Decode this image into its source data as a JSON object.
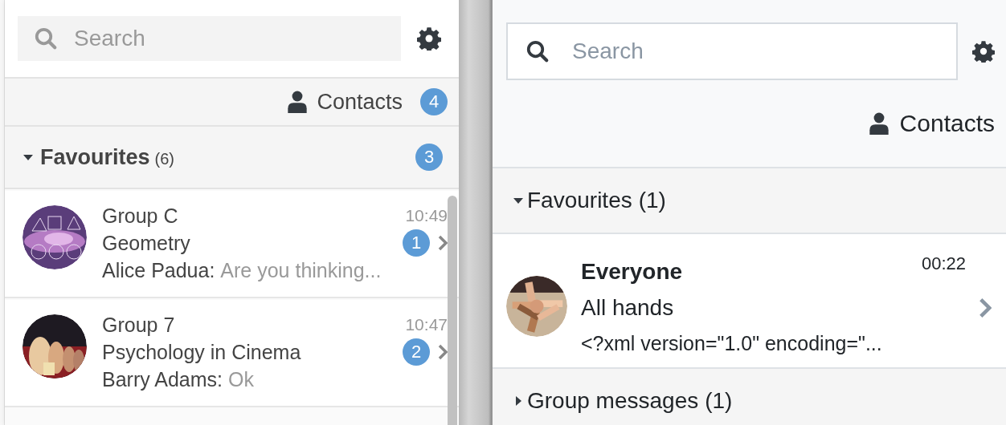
{
  "panels": [
    {
      "kind": "classic",
      "search": {
        "placeholder": "Search"
      },
      "contacts": {
        "label": "Contacts",
        "badge": "4"
      },
      "sections": [
        {
          "title": "Favourites",
          "count": "(6)",
          "expanded": true,
          "badge": "3",
          "conversations": [
            {
              "name": "Group C",
              "time": "10:49",
              "subject": "Geometry",
              "sender": "Alice Padua:",
              "preview": "Are you thinking...",
              "unread": "1",
              "kind": "picture"
            },
            {
              "name": "Group 7",
              "time": "10:47",
              "subject": "Psychology in Cinema",
              "sender": "Barry Adams:",
              "preview": "Ok",
              "unread": "2",
              "kind": "picture"
            }
          ]
        }
      ]
    },
    {
      "kind": "modern",
      "search": {
        "placeholder": "Search"
      },
      "contacts": {
        "label": "Contacts"
      },
      "sections": [
        {
          "title": "Favourites",
          "count": "(1)",
          "expanded": true,
          "conversations": [
            {
              "name": "Everyone",
              "time": "00:22",
              "subject": "All hands",
              "preview": "<?xml version=\"1.0\" encoding=\"...",
              "kind": "picture"
            }
          ]
        },
        {
          "title": "Group messages",
          "count": "(1)",
          "expanded": false
        }
      ]
    }
  ]
}
